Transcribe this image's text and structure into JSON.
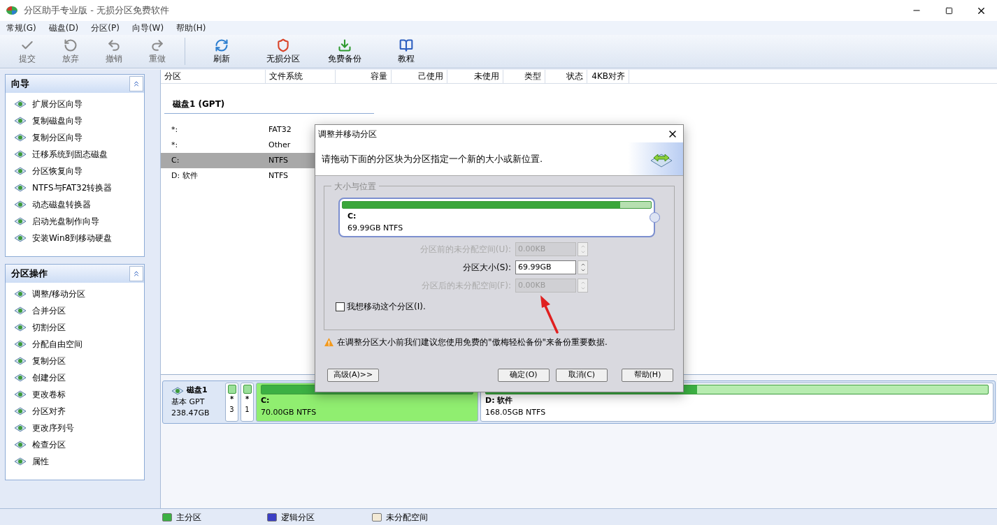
{
  "window": {
    "title": "分区助手专业版 - 无损分区免费软件"
  },
  "menu": [
    "常规(G)",
    "磁盘(D)",
    "分区(P)",
    "向导(W)",
    "帮助(H)"
  ],
  "toolbar": [
    {
      "label": "提交",
      "disabled": true,
      "kind": "check"
    },
    {
      "label": "放弃",
      "disabled": true,
      "kind": "discard"
    },
    {
      "label": "撤销",
      "disabled": true,
      "kind": "undo"
    },
    {
      "label": "重做",
      "disabled": true,
      "kind": "redo"
    },
    {
      "label": "刷新",
      "disabled": false,
      "kind": "refresh"
    },
    {
      "label": "无损分区",
      "disabled": false,
      "kind": "shield"
    },
    {
      "label": "免费备份",
      "disabled": false,
      "kind": "backup"
    },
    {
      "label": "教程",
      "disabled": false,
      "kind": "book"
    }
  ],
  "sidebar": [
    {
      "title": "向导",
      "expanded": true,
      "items": [
        "扩展分区向导",
        "复制磁盘向导",
        "复制分区向导",
        "迁移系统到固态磁盘",
        "分区恢复向导",
        "NTFS与FAT32转换器",
        "动态磁盘转换器",
        "启动光盘制作向导",
        "安装Win8到移动硬盘"
      ]
    },
    {
      "title": "分区操作",
      "expanded": true,
      "items": [
        "调整/移动分区",
        "合并分区",
        "切割分区",
        "分配自由空间",
        "复制分区",
        "创建分区",
        "更改卷标",
        "分区对齐",
        "更改序列号",
        "检查分区",
        "属性"
      ]
    }
  ],
  "table": {
    "columns": [
      "分区",
      "文件系统",
      "容量",
      "己使用",
      "未使用",
      "类型",
      "状态",
      "4KB对齐"
    ],
    "group": "磁盘1 (GPT)",
    "rows": [
      {
        "partition": "*:",
        "filesystem": "FAT32",
        "selected": false
      },
      {
        "partition": "*:",
        "filesystem": "Other",
        "selected": false
      },
      {
        "partition": "C:",
        "filesystem": "NTFS",
        "selected": true
      },
      {
        "partition": "D: 软件",
        "filesystem": "NTFS",
        "selected": false
      }
    ]
  },
  "disk_map": {
    "disk": {
      "name": "磁盘1",
      "type": "基本 GPT",
      "size": "238.47GB"
    },
    "partitions": [
      {
        "kind": "small",
        "label": "*",
        "number": "3",
        "selected": false
      },
      {
        "kind": "small",
        "label": "*",
        "number": "1",
        "selected": false
      },
      {
        "kind": "large",
        "label": "C:",
        "detail": "70.00GB NTFS",
        "selected": true,
        "level": 1
      },
      {
        "kind": "large",
        "label": "D: 软件",
        "detail": "168.05GB NTFS",
        "selected": false,
        "level": 0.42
      }
    ]
  },
  "dialog": {
    "title": "调整并移动分区",
    "instruction": "请拖动下面的分区块为分区指定一个新的大小或新位置.",
    "group_title": "大小与位置",
    "partition": {
      "label": "C:",
      "detail": "69.99GB NTFS",
      "level": 0.9
    },
    "fields": [
      {
        "label": "分区前的未分配空间(U):",
        "value": "0.00KB",
        "disabled": true
      },
      {
        "label": "分区大小(S):",
        "value": "69.99GB",
        "disabled": false
      },
      {
        "label": "分区后的未分配空间(F):",
        "value": "0.00KB",
        "disabled": true
      }
    ],
    "move_checkbox": {
      "label": "我想移动这个分区(I).",
      "checked": false
    },
    "warning": "在调整分区大小前我们建议您使用免费的\"傲梅轻松备份\"来备份重要数据.",
    "buttons": {
      "advanced": "高级(A)>>",
      "ok": "确定(O)",
      "cancel": "取消(C)",
      "help": "帮助(H)"
    }
  },
  "legend": [
    {
      "label": "主分区",
      "color": "#3cb043"
    },
    {
      "label": "逻辑分区",
      "color": "#3b3fc4"
    },
    {
      "label": "未分配空间",
      "color": "#f3ead6"
    }
  ]
}
